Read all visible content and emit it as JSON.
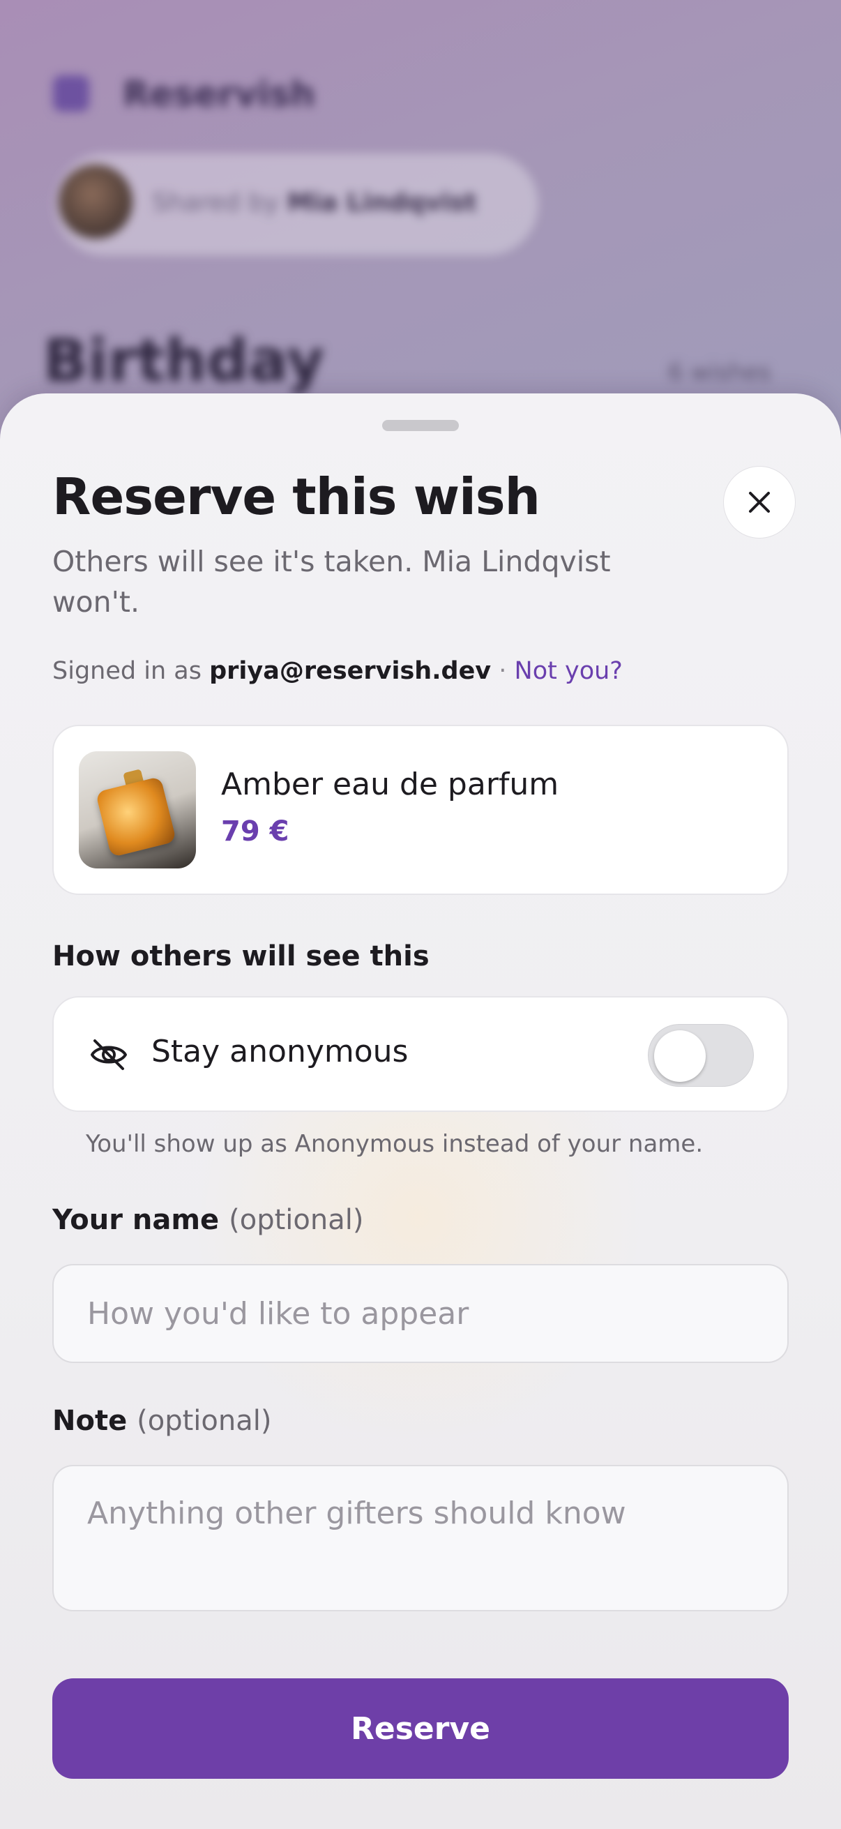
{
  "background": {
    "brand": "Reservish",
    "shared_prefix": "Shared by",
    "shared_owner": "Mia Lindqvist",
    "list_title": "Birthday",
    "wish_count": "6 wishes"
  },
  "sheet": {
    "title": "Reserve this wish",
    "subtitle": "Others will see it's taken. Mia Lindqvist won't.",
    "signed_in_prefix": "Signed in as",
    "signed_in_email": "priya@reservish.dev",
    "separator": "·",
    "not_you": "Not you?",
    "product": {
      "name": "Amber eau de parfum",
      "price": "79 €"
    },
    "visibility_section": "How others will see this",
    "anonymous": {
      "label": "Stay anonymous",
      "enabled": false,
      "hint": "You'll show up as Anonymous instead of your name."
    },
    "name_field": {
      "label": "Your name",
      "optional": "(optional)",
      "placeholder": "How you'd like to appear",
      "value": ""
    },
    "note_field": {
      "label": "Note",
      "optional": "(optional)",
      "placeholder": "Anything other gifters should know",
      "value": ""
    },
    "reserve_label": "Reserve"
  },
  "colors": {
    "accent": "#6e3fa8",
    "price": "#6a3fae",
    "backdrop": "#a596b6"
  },
  "icons": {
    "close": "close-icon",
    "anonymous": "eye-off-icon"
  }
}
